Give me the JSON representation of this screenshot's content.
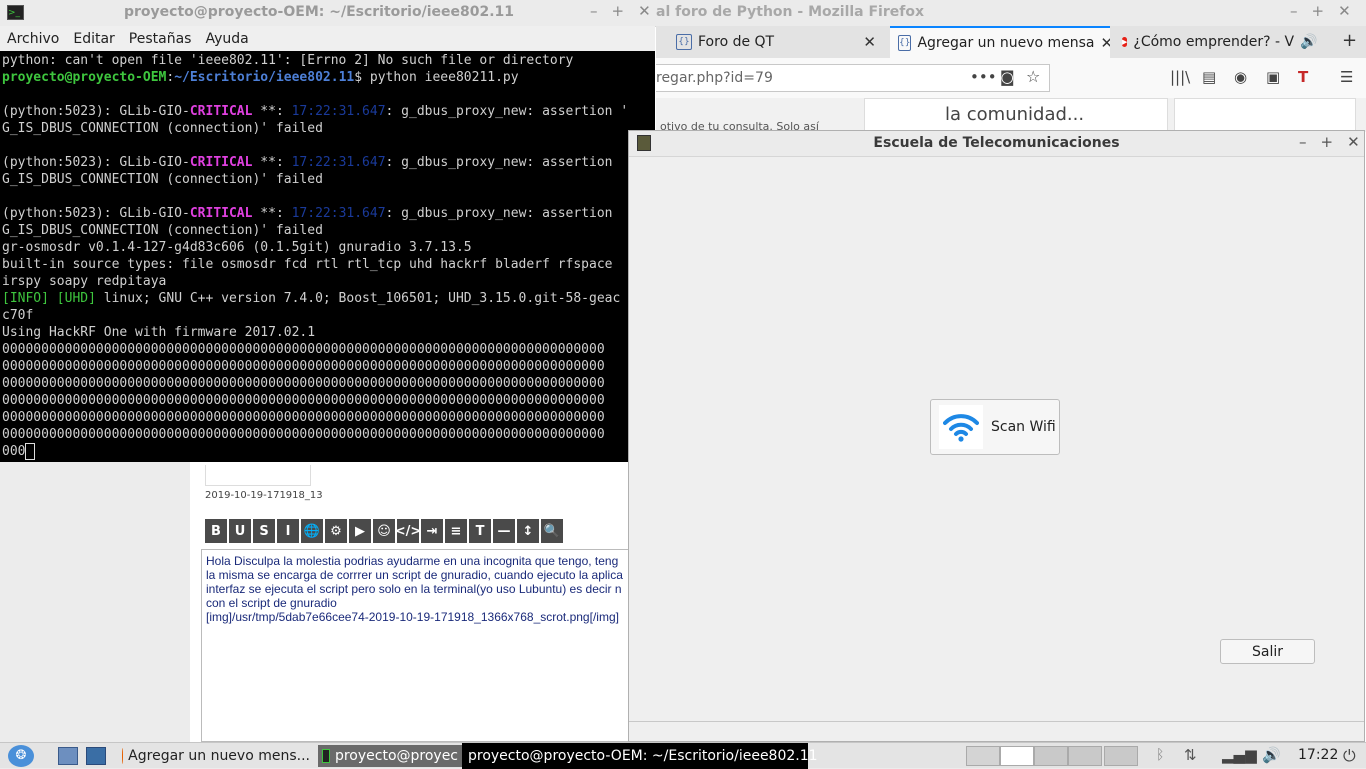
{
  "firefox": {
    "title": "al foro de Python - Mozilla Firefox",
    "tabs": [
      {
        "label": "Foro de QT",
        "active": false
      },
      {
        "label": "Agregar un nuevo mensa",
        "active": true
      },
      {
        "label": "¿Cómo emprender? - V",
        "active": false
      }
    ],
    "url": "regar.php?id=79",
    "new_tab": "+",
    "page": {
      "snippet": "otivo de tu consulta. Solo así",
      "card_text": "la comunidad...",
      "file_name": "2019-10-19-171918_13",
      "toolbar": [
        "B",
        "U",
        "S",
        "I",
        "🌐",
        "⚙",
        "▶",
        "☺",
        "</>",
        "⇥",
        "≡",
        "T",
        "—",
        "↕",
        "🔍"
      ],
      "message_lines": [
        "Hola Disculpa la molestia podrias  ayudarme en una incognita que tengo, teng",
        "la misma se encarga de corrrer un script de gnuradio, cuando ejecuto la aplica",
        "interfaz se ejecuta el script pero solo en la terminal(yo uso Lubuntu) es decir n",
        "con el script de gnuradio",
        "[img]/usr/tmp/5dab7e66cee74-2019-10-19-171918_1366x768_scrot.png[/img]"
      ]
    }
  },
  "terminal": {
    "title": "proyecto@proyecto-OEM: ~/Escritorio/ieee802.11",
    "menu": [
      "Archivo",
      "Editar",
      "Pestañas",
      "Ayuda"
    ],
    "lines": [
      "python: can't open file 'ieee802.11': [Errno 2] No such file or directory",
      "",
      "",
      "(python:5023): GLib-GIO-",
      "G_IS_DBUS_CONNECTION (connection)' failed",
      "",
      "(python:5023): GLib-GIO-",
      "G_IS_DBUS_CONNECTION (connection)' failed",
      "",
      "(python:5023): GLib-GIO-",
      "G_IS_DBUS_CONNECTION (connection)' failed",
      "gr-osmosdr v0.1.4-127-g4d83c606 (0.1.5git) gnuradio 3.7.13.5",
      "built-in source types: file osmosdr fcd rtl rtl_tcp uhd hackrf bladerf rfspace",
      "irspy soapy redpitaya",
      " linux; GNU C++ version 7.4.0; Boost_106501; UHD_3.15.0.git-58-geac",
      "c70f",
      "Using HackRF One with firmware 2017.02.1",
      "00000000000000000000000000000000000000000000000000000000000000000000000000000",
      "00000000000000000000000000000000000000000000000000000000000000000000000000000",
      "00000000000000000000000000000000000000000000000000000000000000000000000000000",
      "00000000000000000000000000000000000000000000000000000000000000000000000000000",
      "00000000000000000000000000000000000000000000000000000000000000000000000000000",
      "00000000000000000000000000000000000000000000000000000000000000000000000000000",
      "000"
    ],
    "prompt_user": "proyecto@proyecto-OEM",
    "prompt_sep": ":",
    "prompt_path": "~/Escritorio/ieee802.11",
    "prompt_cmd": "$ python ieee80211.py",
    "critical": "CRITICAL",
    "critical_rest": " **: ",
    "timestamp": "17:22:31.647",
    "proxy_msg_1": ": g_dbus_proxy_new: assertion '",
    "proxy_msg": ": g_dbus_proxy_new: assertion",
    "info_tag": "[INFO] [UHD]"
  },
  "app": {
    "title": "Escuela de Telecomunicaciones",
    "scan_button": "Scan Wifi",
    "exit_button": "Salir",
    "wifi_color": "#1e88e5"
  },
  "taskbar": {
    "items": [
      {
        "label": "Agregar un nuevo mens..."
      },
      {
        "label": "proyecto@proyec"
      }
    ],
    "active_item": "proyecto@proyecto-OEM: ~/Escritorio/ieee802.11",
    "clock": "17:22"
  }
}
